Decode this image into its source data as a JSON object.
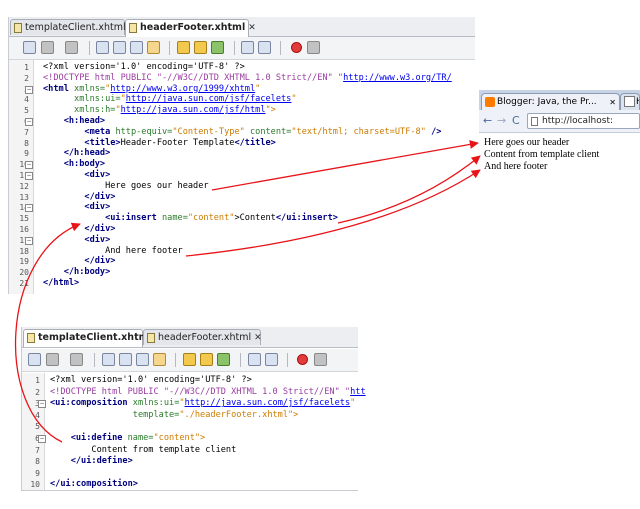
{
  "top_editor": {
    "tabs": [
      {
        "label": "templateClient.xhtml",
        "close": "✕"
      },
      {
        "label": "headerFooter.xhtml",
        "close": "✕"
      }
    ],
    "lines": [
      [
        {
          "t": "<?xml version='1.0' encoding='UTF-8' ?>",
          "c": ""
        }
      ],
      [
        {
          "t": "<!DOCTYPE html PUBLIC \"-//W3C//DTD XHTML 1.0 Strict//EN\" \"",
          "c": "d"
        },
        {
          "t": "http://www.w3.org/TR/",
          "c": "u"
        }
      ],
      [
        {
          "t": "<html ",
          "c": "k"
        },
        {
          "t": "xmlns=",
          "c": "a"
        },
        {
          "t": "\"",
          "c": "v"
        },
        {
          "t": "http://www.w3.org/1999/xhtml",
          "c": "u"
        },
        {
          "t": "\"",
          "c": "v"
        }
      ],
      [
        {
          "t": "      xmlns:ui=",
          "c": "a"
        },
        {
          "t": "\"",
          "c": "v"
        },
        {
          "t": "http://java.sun.com/jsf/facelets",
          "c": "u"
        },
        {
          "t": "\"",
          "c": "v"
        }
      ],
      [
        {
          "t": "      xmlns:h=",
          "c": "a"
        },
        {
          "t": "\"",
          "c": "v"
        },
        {
          "t": "http://java.sun.com/jsf/html",
          "c": "u"
        },
        {
          "t": "\">",
          "c": "v"
        }
      ],
      [
        {
          "t": "    <h:head>",
          "c": "k"
        }
      ],
      [
        {
          "t": "        <meta ",
          "c": "k"
        },
        {
          "t": "http-equiv=",
          "c": "a"
        },
        {
          "t": "\"Content-Type\" ",
          "c": "v"
        },
        {
          "t": "content=",
          "c": "a"
        },
        {
          "t": "\"text/html; charset=UTF-8\"",
          "c": "v"
        },
        {
          "t": " />",
          "c": "k"
        }
      ],
      [
        {
          "t": "        <title>",
          "c": "k"
        },
        {
          "t": "Header-Footer Template",
          "c": ""
        },
        {
          "t": "</title>",
          "c": "k"
        }
      ],
      [
        {
          "t": "    </h:head>",
          "c": "k"
        }
      ],
      [
        {
          "t": "    <h:body>",
          "c": "k"
        }
      ],
      [
        {
          "t": "        <div>",
          "c": "k"
        }
      ],
      [
        {
          "t": "            Here goes our header",
          "c": ""
        }
      ],
      [
        {
          "t": "        </div>",
          "c": "k"
        }
      ],
      [
        {
          "t": "        <div>",
          "c": "k"
        }
      ],
      [
        {
          "t": "            <ui:insert ",
          "c": "k"
        },
        {
          "t": "name=",
          "c": "a"
        },
        {
          "t": "\"content\"",
          "c": "v"
        },
        {
          "t": ">Content",
          "c": ""
        },
        {
          "t": "</ui:insert>",
          "c": "k"
        }
      ],
      [
        {
          "t": "        </div>",
          "c": "k"
        }
      ],
      [
        {
          "t": "        <div>",
          "c": "k"
        }
      ],
      [
        {
          "t": "            And here footer",
          "c": ""
        }
      ],
      [
        {
          "t": "        </div>",
          "c": "k"
        }
      ],
      [
        {
          "t": "    </h:body>",
          "c": "k"
        }
      ],
      [
        {
          "t": "</html>",
          "c": "k"
        }
      ]
    ]
  },
  "bottom_editor": {
    "tabs": [
      {
        "label": "templateClient.xhtml",
        "close": "✕"
      },
      {
        "label": "headerFooter.xhtml",
        "close": "✕"
      }
    ],
    "lines": [
      [
        {
          "t": "<?xml version='1.0' encoding='UTF-8' ?>",
          "c": ""
        }
      ],
      [
        {
          "t": "<!DOCTYPE html PUBLIC \"-//W3C//DTD XHTML 1.0 Strict//EN\" \"",
          "c": "d"
        },
        {
          "t": "htt",
          "c": "u"
        }
      ],
      [
        {
          "t": "<ui:composition ",
          "c": "k"
        },
        {
          "t": "xmlns:ui=",
          "c": "a"
        },
        {
          "t": "\"",
          "c": "v"
        },
        {
          "t": "http://java.sun.com/jsf/facelets",
          "c": "u"
        },
        {
          "t": "\"",
          "c": "v"
        }
      ],
      [
        {
          "t": "                template=",
          "c": "a"
        },
        {
          "t": "\"./headerFooter.xhtml\">",
          "c": "v"
        }
      ],
      [
        {
          "t": "",
          "c": ""
        }
      ],
      [
        {
          "t": "    <ui:define ",
          "c": "k"
        },
        {
          "t": "name=",
          "c": "a"
        },
        {
          "t": "\"content\">",
          "c": "v"
        }
      ],
      [
        {
          "t": "        Content from template client",
          "c": ""
        }
      ],
      [
        {
          "t": "    </ui:define>",
          "c": "k"
        }
      ],
      [
        {
          "t": "",
          "c": ""
        }
      ],
      [
        {
          "t": "</ui:composition>",
          "c": "k"
        }
      ]
    ]
  },
  "browser": {
    "tab1_title": "Blogger: Java, the Pr...",
    "tab1_close": "✕",
    "tab2_title": "H",
    "url": "http://localhost:",
    "back": "←",
    "forward": "→",
    "reload": "C",
    "star": "☆",
    "page_lines": [
      "Here goes our header",
      "Content from template client",
      "And here footer"
    ]
  },
  "colors": {
    "arrow": "#e8141a"
  }
}
